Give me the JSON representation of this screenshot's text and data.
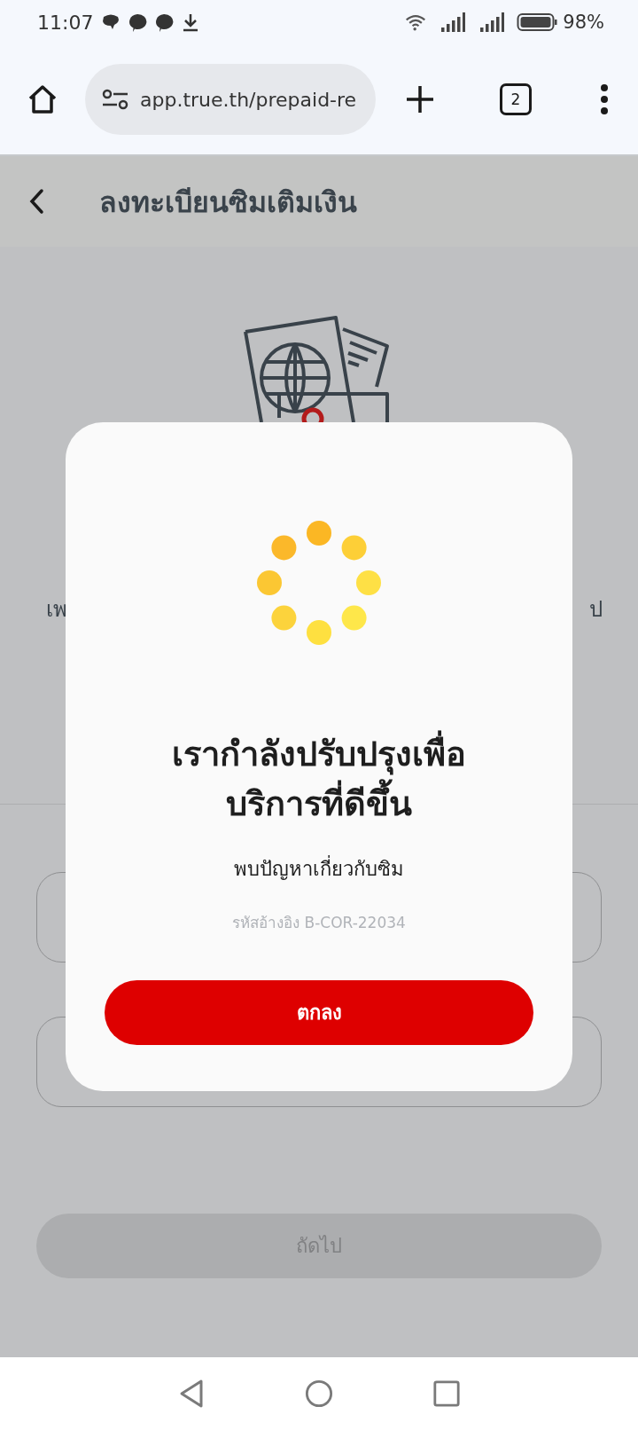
{
  "status_bar": {
    "time": "11:07",
    "battery": "98%"
  },
  "browser": {
    "url": "app.true.th/prepaid-re",
    "tab_count": "2"
  },
  "header": {
    "title": "ลงทะเบียนซิมเติมเงิน"
  },
  "background_text": {
    "left": "เพ",
    "right": "ป"
  },
  "next_button": {
    "label": "ถัดไป",
    "disabled": true
  },
  "dialog": {
    "title": "เรากำลังปรับปรุงเพื่อ\nบริการที่ดีขึ้น",
    "message": "พบปัญหาเกี่ยวกับซิม",
    "reference": "รหัสอ้างอิง B-COR-22034",
    "button": "ตกลง"
  }
}
